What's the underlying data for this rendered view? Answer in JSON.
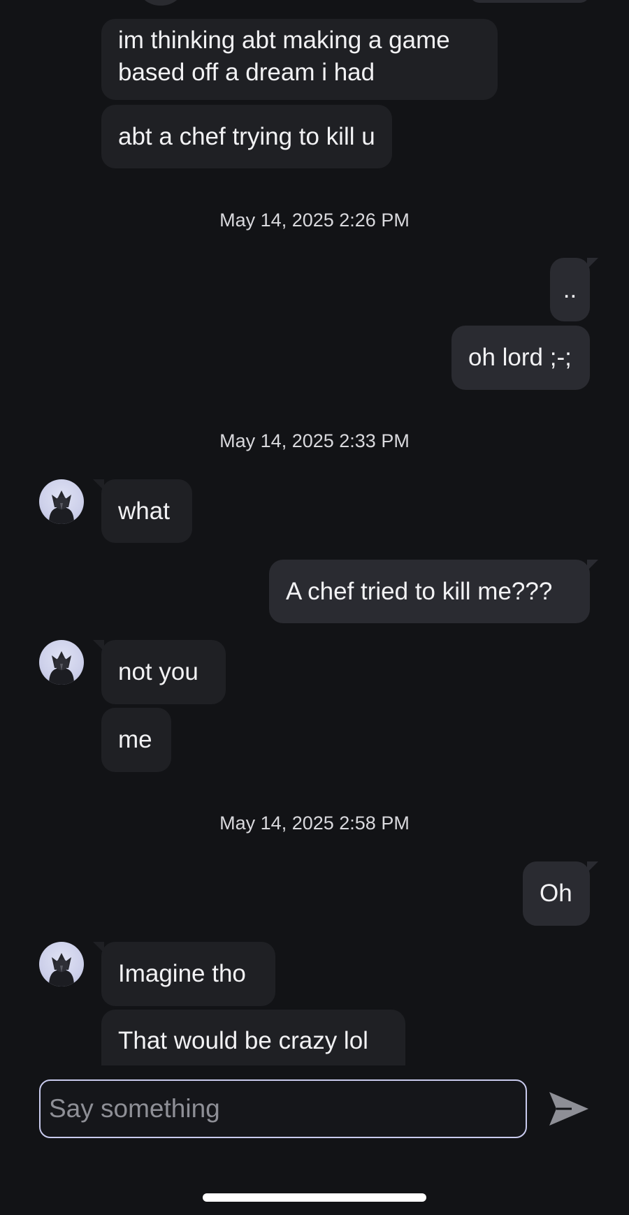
{
  "messages": [
    {
      "id": "m1",
      "side": "in",
      "text": "im thinking abt making a game based off a dream i had"
    },
    {
      "id": "m2",
      "side": "in",
      "text": "abt a chef trying to kill u"
    },
    {
      "id": "t1",
      "type": "timestamp",
      "text": "May 14, 2025 2:26 PM"
    },
    {
      "id": "m3",
      "side": "out",
      "text": ".."
    },
    {
      "id": "m4",
      "side": "out",
      "text": "oh lord ;-;"
    },
    {
      "id": "t2",
      "type": "timestamp",
      "text": "May 14, 2025 2:33 PM"
    },
    {
      "id": "m5",
      "side": "in",
      "text": "what"
    },
    {
      "id": "m6",
      "side": "out",
      "text": "A chef tried to kill me???"
    },
    {
      "id": "m7",
      "side": "in",
      "text": "not you"
    },
    {
      "id": "m8",
      "side": "in",
      "text": "me"
    },
    {
      "id": "t3",
      "type": "timestamp",
      "text": "May 14, 2025 2:58 PM"
    },
    {
      "id": "m9",
      "side": "out",
      "text": "Oh"
    },
    {
      "id": "m10",
      "side": "in",
      "text": "Imagine tho"
    },
    {
      "id": "m11",
      "side": "in",
      "text": "That would be crazy lol"
    }
  ],
  "composer": {
    "placeholder": "Say something",
    "value": ""
  },
  "icons": {
    "send": "send-icon",
    "avatar": "contact-avatar"
  },
  "colors": {
    "background": "#121316",
    "incoming_bubble": "#1f2024",
    "outgoing_bubble": "#2a2b31",
    "composer_border": "#c9cbee",
    "send_icon": "#8e8f96"
  }
}
